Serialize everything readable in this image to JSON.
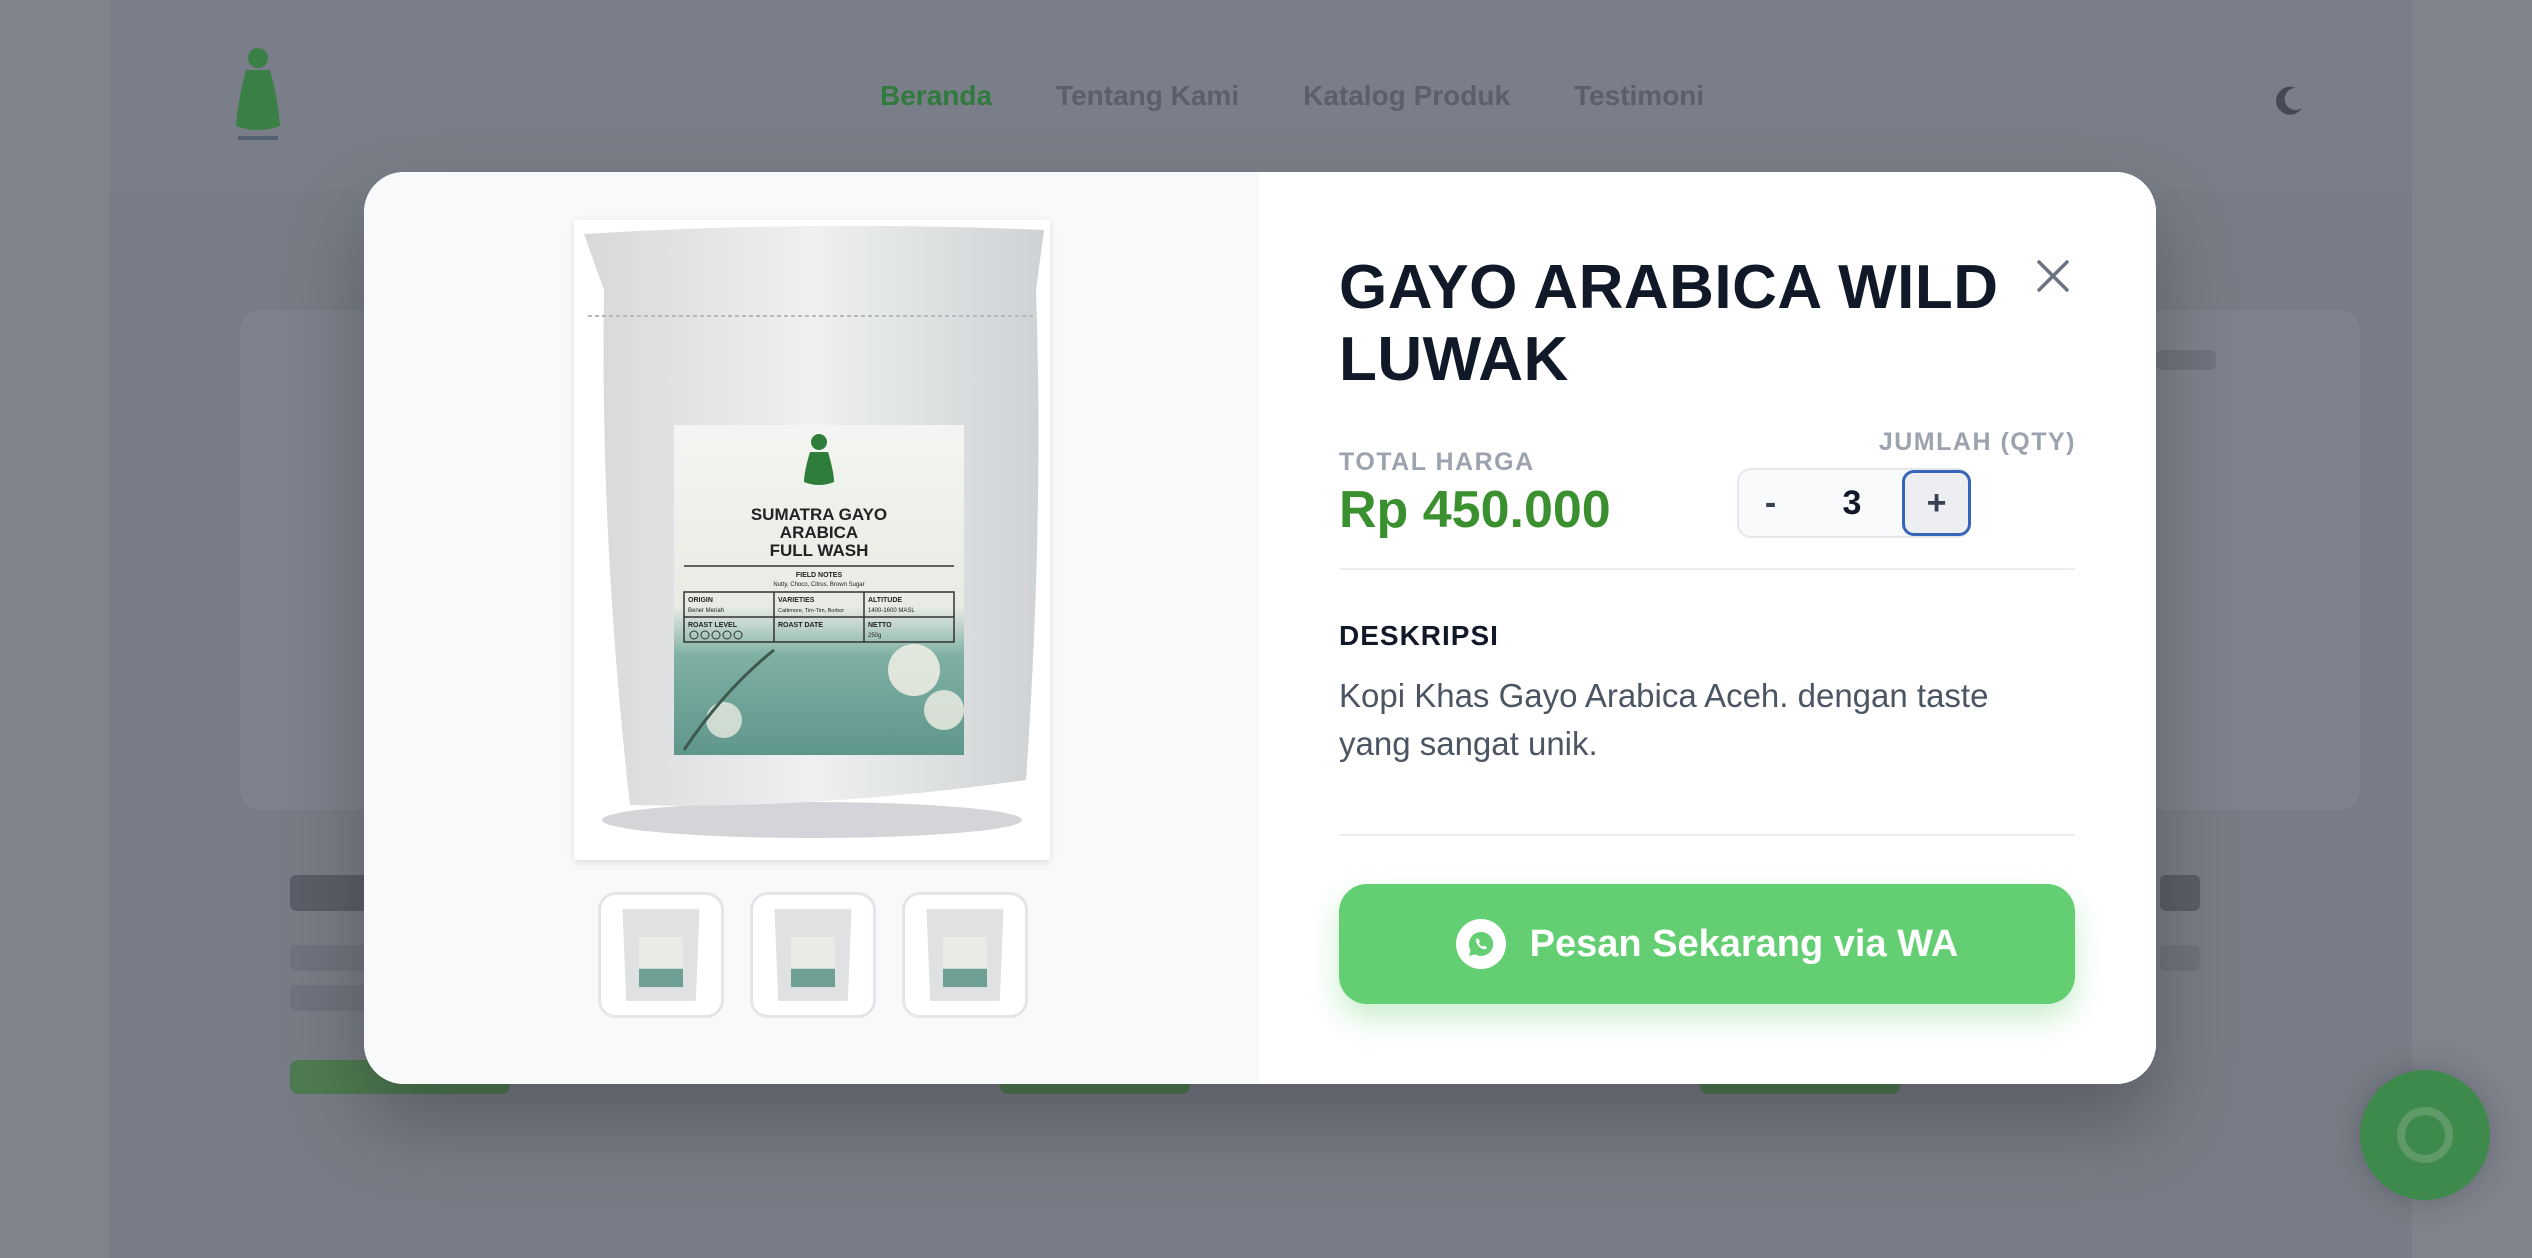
{
  "background": {
    "nav_links": [
      "Beranda",
      "Tentang Kami",
      "Katalog Produk",
      "Testimoni"
    ]
  },
  "product": {
    "title": "GAYO ARABICA WILD LUWAK",
    "total_label": "TOTAL HARGA",
    "total_value": "Rp 450.000",
    "qty_label": "JUMLAH (QTY)",
    "qty_value": "3",
    "qty_minus": "-",
    "qty_plus": "+",
    "description_label": "DESKRIPSI",
    "description": "Kopi Khas Gayo Arabica Aceh. dengan taste yang sangat unik.",
    "order_button": "Pesan Sekarang via WA",
    "bag_label": {
      "line1": "SUMATRA GAYO",
      "line2": "ARABICA",
      "line3": "FULL WASH",
      "field_notes": "FIELD NOTES",
      "notes_value": "Nutty, Choco, Citrus, Brown Sugar",
      "origin": "ORIGIN",
      "origin_value": "Bener Meriah",
      "varieties": "VARIETIES",
      "varieties_value": "Cattimore, Tim-Tim, Borbor",
      "altitude": "ALTITUDE",
      "altitude_value": "1400-1600 MASL",
      "roast_level": "ROAST LEVEL",
      "roast_date": "ROAST DATE",
      "netto": "NETTO",
      "netto_value": "250g"
    }
  },
  "colors": {
    "price": "#3a8f2f",
    "wa_button": "#64cf72",
    "qty_plus_border": "#3566b8"
  },
  "icons": {
    "close": "close-icon",
    "whatsapp": "whatsapp-icon"
  }
}
